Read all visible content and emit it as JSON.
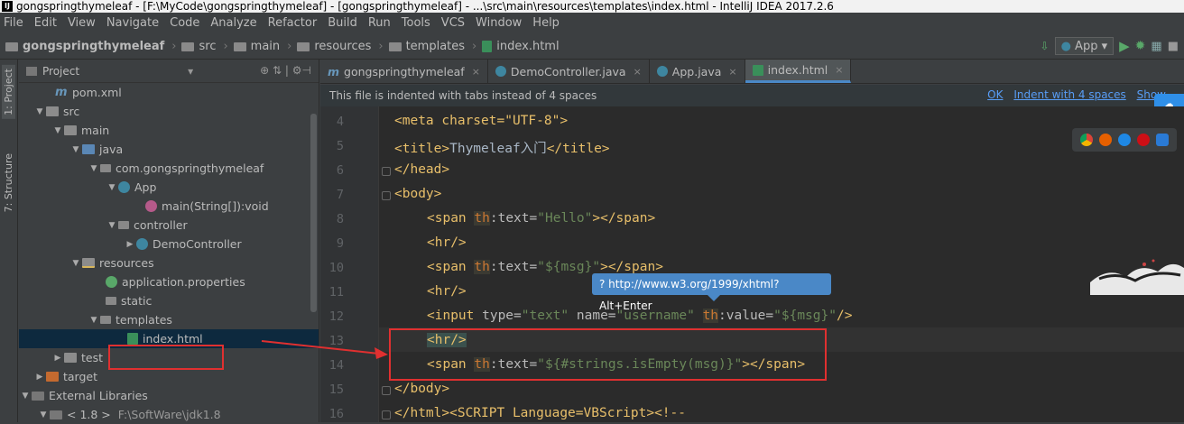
{
  "window": {
    "title": "gongspringthymeleaf - [F:\\MyCode\\gongspringthymeleaf] - [gongspringthymeleaf] - ...\\src\\main\\resources\\templates\\index.html - IntelliJ IDEA 2017.2.6"
  },
  "menu": [
    "File",
    "Edit",
    "View",
    "Navigate",
    "Code",
    "Analyze",
    "Refactor",
    "Build",
    "Run",
    "Tools",
    "VCS",
    "Window",
    "Help"
  ],
  "breadcrumb": [
    "gongspringthymeleaf",
    "src",
    "main",
    "resources",
    "templates",
    "index.html"
  ],
  "run_config": {
    "label": "App",
    "run_icon": "play-icon",
    "debug_icon": "bug-icon"
  },
  "side_tabs": {
    "project": "1: Project",
    "structure": "7: Structure"
  },
  "project_panel": {
    "title": "Project",
    "tree": [
      {
        "label": "pom.xml",
        "icon": "maven-icon"
      },
      {
        "label": "src",
        "icon": "folder-icon"
      },
      {
        "label": "main",
        "icon": "folder-icon"
      },
      {
        "label": "java",
        "icon": "source-folder-icon"
      },
      {
        "label": "com.gongspringthymeleaf",
        "icon": "package-icon"
      },
      {
        "label": "App",
        "icon": "class-icon"
      },
      {
        "label": "main(String[]):void",
        "icon": "method-icon"
      },
      {
        "label": "controller",
        "icon": "package-icon"
      },
      {
        "label": "DemoController",
        "icon": "class-icon"
      },
      {
        "label": "resources",
        "icon": "resources-folder-icon"
      },
      {
        "label": "application.properties",
        "icon": "properties-icon"
      },
      {
        "label": "static",
        "icon": "package-icon"
      },
      {
        "label": "templates",
        "icon": "package-icon"
      },
      {
        "label": "index.html",
        "icon": "html-icon"
      },
      {
        "label": "test",
        "icon": "folder-icon"
      },
      {
        "label": "target",
        "icon": "folder-icon"
      },
      {
        "label": "External Libraries",
        "icon": "library-icon"
      },
      {
        "label": "< 1.8 >",
        "icon": "jdk-icon",
        "extra": "F:\\SoftWare\\jdk1.8"
      }
    ]
  },
  "editor_tabs": [
    {
      "label": "gongspringthymeleaf",
      "icon": "maven-icon",
      "active": false
    },
    {
      "label": "DemoController.java",
      "icon": "class-icon",
      "active": false
    },
    {
      "label": "App.java",
      "icon": "class-icon",
      "active": false
    },
    {
      "label": "index.html",
      "icon": "html-icon",
      "active": true
    }
  ],
  "banner": {
    "message": "This file is indented with tabs instead of 4 spaces",
    "ok": "OK",
    "indent": "Indent with 4 spaces",
    "show": "Show"
  },
  "tooltip": "? http://www.w3.org/1999/xhtml? Alt+Enter",
  "line_numbers": [
    "4",
    "5",
    "6",
    "7",
    "8",
    "9",
    "10",
    "11",
    "12",
    "13",
    "14",
    "15",
    "16"
  ],
  "code": {
    "l4": "<meta charset=\"UTF-8\">",
    "l5_open": "<title>",
    "l5_text": "Thymeleaf入门",
    "l5_close": "</title>",
    "l6": "</head>",
    "l7": "<body>",
    "l8_tag": "<span ",
    "l8_th": "th",
    "l8_attr": ":text=",
    "l8_str": "\"Hello\"",
    "l8_close": "></span>",
    "l9": "<hr/>",
    "l10_tag": "<span ",
    "l10_th": "th",
    "l10_attr": ":text=",
    "l10_str": "\"${msg}\"",
    "l10_close": "></span>",
    "l11": "<hr/>",
    "l12_tag": "<input ",
    "l12_a1": "type=",
    "l12_s1": "\"text\" ",
    "l12_a2": "name=",
    "l12_s2": "\"username\" ",
    "l12_th": "th",
    "l12_a3": ":value=",
    "l12_s3": "\"${msg}\"",
    "l12_close": "/>",
    "l13": "<hr/>",
    "l14_tag": "<span ",
    "l14_th": "th",
    "l14_attr": ":text=",
    "l14_str": "\"${#strings.isEmpty(msg)}\"",
    "l14_close": "></span>",
    "l15": "</body>",
    "l16_tag": "</html>",
    "l16_rest": "<SCRIPT Language=VBScript><!--"
  }
}
